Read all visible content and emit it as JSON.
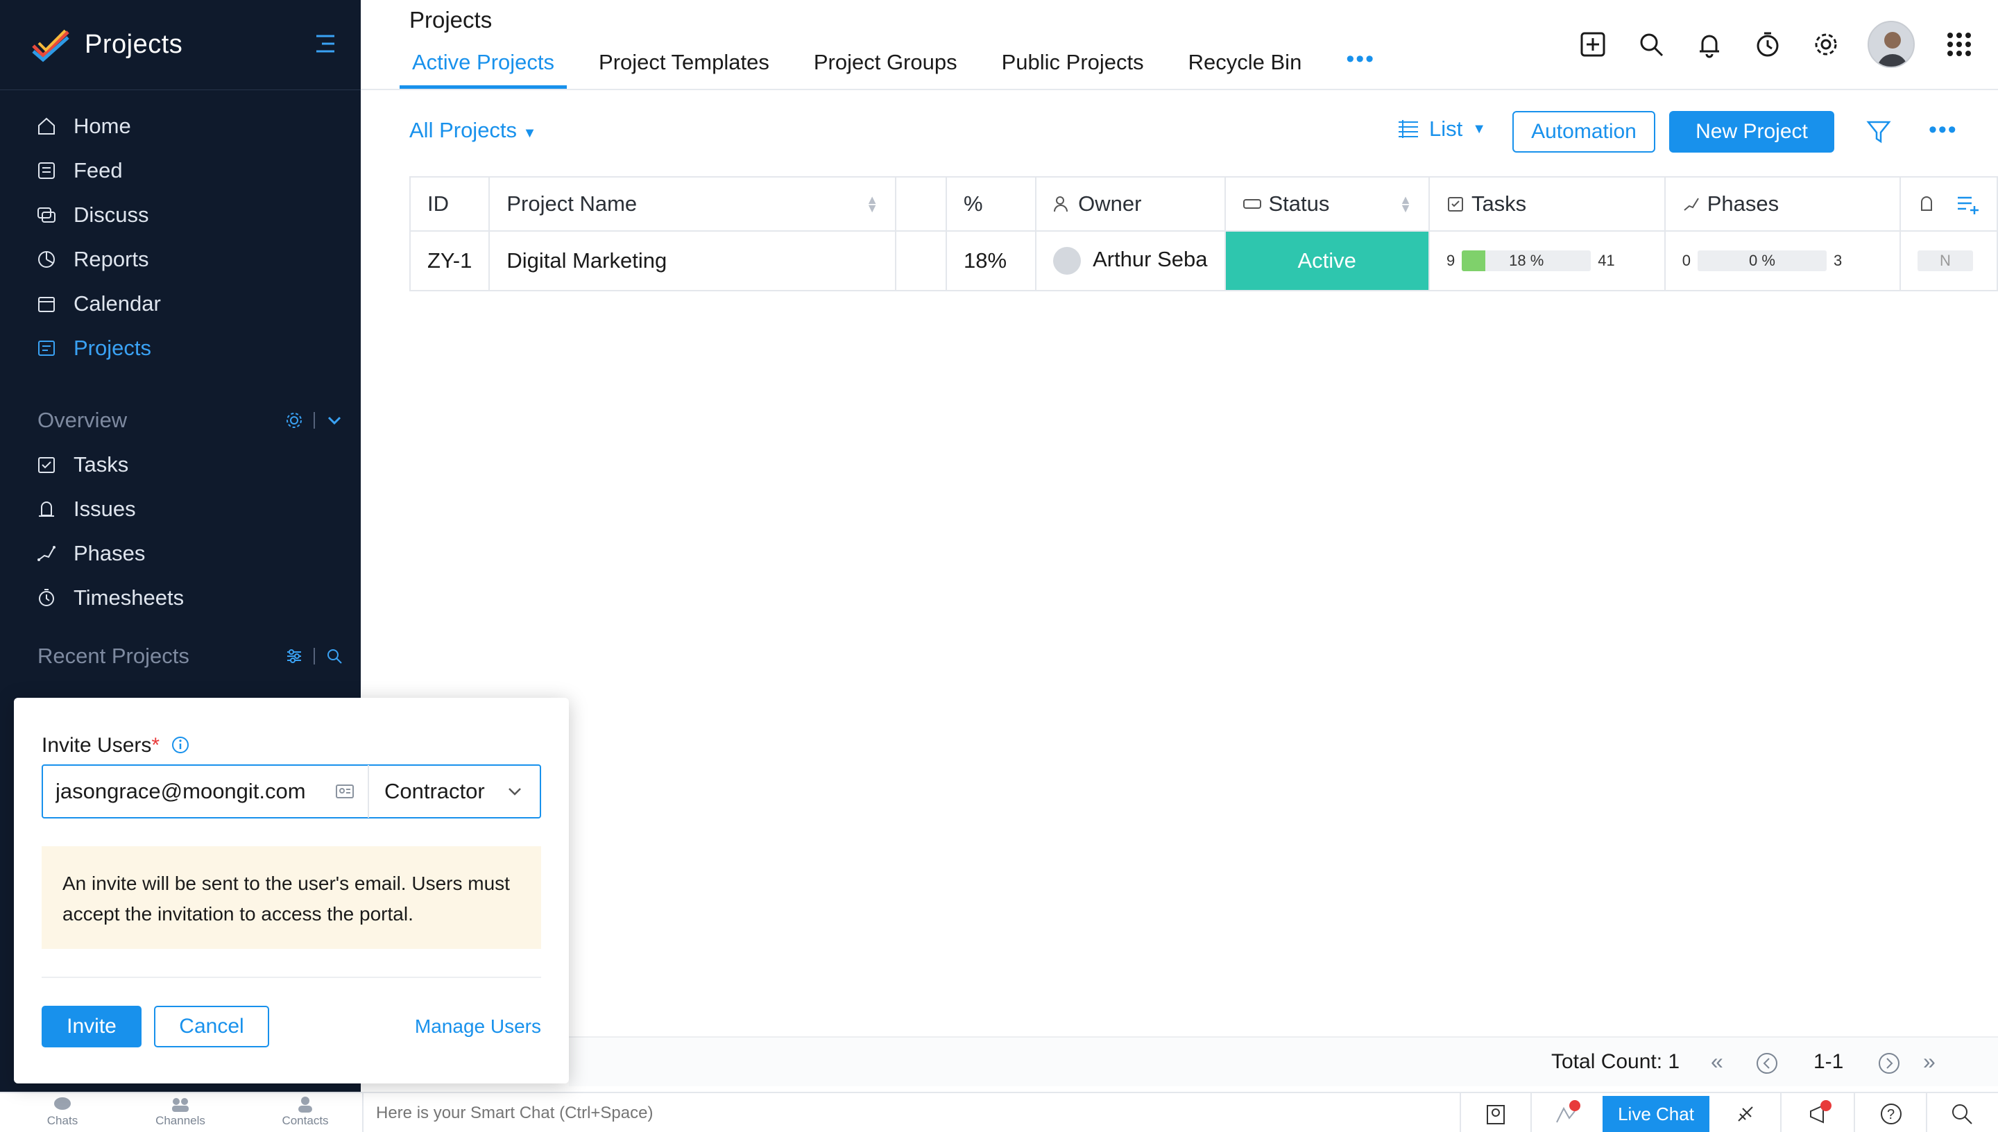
{
  "sidebar": {
    "brand": "Projects",
    "nav": [
      {
        "label": "Home",
        "icon": "home-icon"
      },
      {
        "label": "Feed",
        "icon": "feed-icon"
      },
      {
        "label": "Discuss",
        "icon": "discuss-icon"
      },
      {
        "label": "Reports",
        "icon": "reports-icon"
      },
      {
        "label": "Calendar",
        "icon": "calendar-icon"
      },
      {
        "label": "Projects",
        "icon": "projects-icon",
        "active": true
      }
    ],
    "overview_title": "Overview",
    "overview": [
      {
        "label": "Tasks",
        "icon": "tasks-icon"
      },
      {
        "label": "Issues",
        "icon": "issues-icon"
      },
      {
        "label": "Phases",
        "icon": "phases-icon"
      },
      {
        "label": "Timesheets",
        "icon": "timesheets-icon"
      }
    ],
    "recent_title": "Recent Projects"
  },
  "header": {
    "title": "Projects",
    "tabs": [
      "Active Projects",
      "Project Templates",
      "Project Groups",
      "Public Projects",
      "Recycle Bin"
    ],
    "active_tab": "Active Projects",
    "more": "•••"
  },
  "toolbar": {
    "filter_label": "All Projects",
    "view_label": "List",
    "automation_label": "Automation",
    "new_project_label": "New Project",
    "more": "•••"
  },
  "table": {
    "columns": [
      "ID",
      "Project Name",
      "",
      "%",
      "Owner",
      "Status",
      "Tasks",
      "Phases"
    ],
    "rows": [
      {
        "id": "ZY-1",
        "name": "Digital Marketing",
        "percent": "18%",
        "owner": "Arthur Seba",
        "status": "Active",
        "tasks_done": "9",
        "tasks_pct": "18 %",
        "tasks_pct_value": 18,
        "tasks_total": "41",
        "phases_done": "0",
        "phases_pct": "0 %",
        "phases_pct_value": 0,
        "phases_total": "3",
        "extra": "N"
      }
    ]
  },
  "pager": {
    "total": "Total Count: 1",
    "range": "1-1"
  },
  "chatbar": {
    "tabs": [
      "Chats",
      "Channels",
      "Contacts"
    ],
    "smart_chat_placeholder": "Here is your Smart Chat (Ctrl+Space)",
    "live_chat": "Live Chat"
  },
  "invite": {
    "label": "Invite Users",
    "required": "*",
    "email": "jasongrace@moongit.com",
    "role": "Contractor",
    "note": "An invite will be sent to the user's email. Users must accept the invitation to access the portal.",
    "invite_btn": "Invite",
    "cancel_btn": "Cancel",
    "manage_users": "Manage Users"
  },
  "colors": {
    "accent": "#1891ec",
    "sidebar_bg": "#0f1a2c",
    "status_active": "#2ec6ae",
    "progress_fill": "#7fd16b"
  }
}
